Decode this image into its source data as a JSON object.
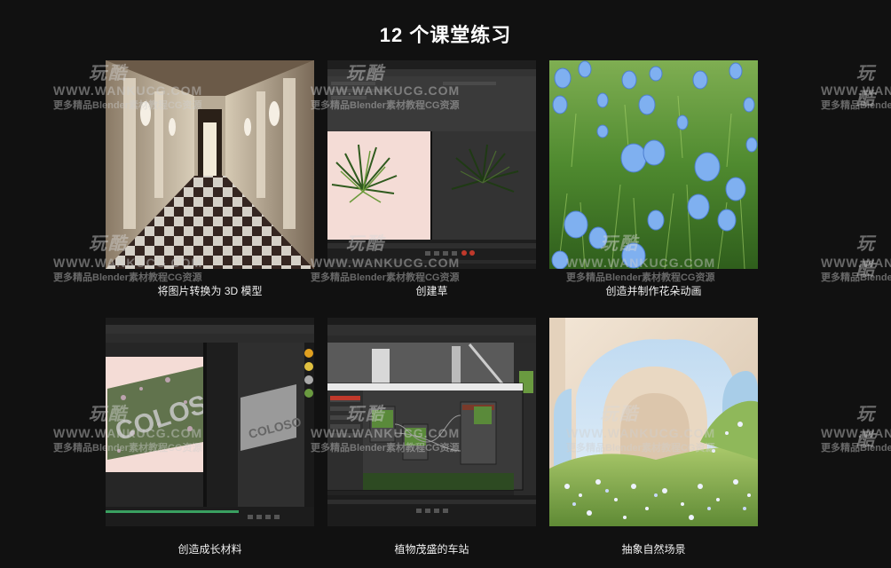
{
  "page": {
    "title": "12 个课堂练习",
    "background": "#111111"
  },
  "watermark": {
    "logo": "玩酷",
    "site": "WWW.WANKUCG.COM",
    "tagline": "更多精品Blender素材教程CG资源"
  },
  "lessons": [
    {
      "caption": "将图片转换为 3D 模型",
      "thumbnail": "checkered-hallway-image"
    },
    {
      "caption": "创建草",
      "thumbnail": "grass-modeling-viewport"
    },
    {
      "caption": "创造并制作花朵动画",
      "thumbnail": "blue-flowers-field-image"
    },
    {
      "caption": "创造成长材料",
      "thumbnail": "coloso-growth-material-viewport"
    },
    {
      "caption": "植物茂盛的车站",
      "thumbnail": "station-plant-node-editor"
    },
    {
      "caption": "抽象自然场景",
      "thumbnail": "arch-nature-scene-image"
    }
  ],
  "thumb_text": {
    "coloso": "COLOSO"
  }
}
